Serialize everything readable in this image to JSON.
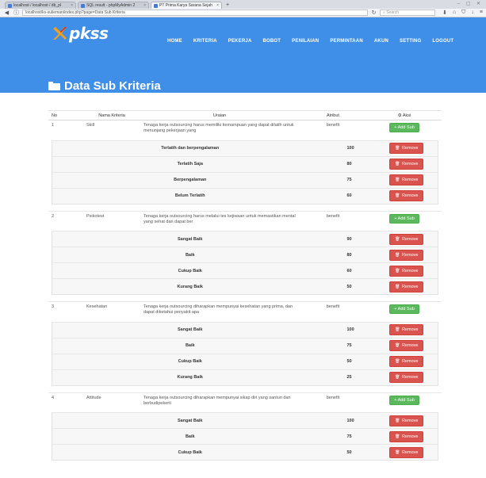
{
  "browser": {
    "tabs": [
      {
        "label": "localhost / localhost / db_pl"
      },
      {
        "label": "SQL result - phpMyAdmin 2"
      },
      {
        "label": "PT Prima Karya Sarana Sejah"
      }
    ],
    "new_tab": "+",
    "url": "localhost/ks-sulieman/index.php?page=Data Sub Kriteria",
    "search_placeholder": "Search"
  },
  "header": {
    "logo": "pkss",
    "menu": [
      "HOME",
      "KRITERIA",
      "PEKERJA",
      "BOBOT",
      "PENILAIAN",
      "PERMINTAAN",
      "AKUN",
      "SETTING",
      "LOGOUT"
    ],
    "page_title": "Data Sub Kriteria"
  },
  "table": {
    "columns": {
      "no": "No",
      "nama": "Nama Kriteria",
      "uraian": "Uraian",
      "atribut": "Atribut",
      "aksi": "Aksi"
    },
    "add_label": "+ Add Sub",
    "remove_label": "Remove",
    "criteria": [
      {
        "no": "1",
        "nama": "Skill",
        "uraian": "Tenaga kerja outsourcing harus memiliki kemampuan yang dapat dilatih untuk menunjang pekerjaan yang",
        "atribut": "benefit",
        "subs": [
          {
            "name": "Terlatih dan berpengalaman",
            "value": "100"
          },
          {
            "name": "Terlatih Saja",
            "value": "80"
          },
          {
            "name": "Berpengalaman",
            "value": "75"
          },
          {
            "name": "Belum Terlatih",
            "value": "60"
          }
        ]
      },
      {
        "no": "2",
        "nama": "Psikotest",
        "uraian": "Tenaga kerja outsourcing harus melalui tes kejiwaan untuk memastikan mental yang sehat dan dapat ber",
        "atribut": "benefit",
        "subs": [
          {
            "name": "Sangat Baik",
            "value": "90"
          },
          {
            "name": "Baik",
            "value": "80"
          },
          {
            "name": "Cukup Baik",
            "value": "60"
          },
          {
            "name": "Kurang Baik",
            "value": "50"
          }
        ]
      },
      {
        "no": "3",
        "nama": "Kesehatan",
        "uraian": "Tenaga kerja outsourcing diharapkan mempunyai kesehatan yang prima, dan dapat diketahui penyakit apa",
        "atribut": "benefit",
        "subs": [
          {
            "name": "Sangat Baik",
            "value": "100"
          },
          {
            "name": "Baik",
            "value": "75"
          },
          {
            "name": "Cukup Baik",
            "value": "50"
          },
          {
            "name": "Kurang Baik",
            "value": "25"
          }
        ]
      },
      {
        "no": "4",
        "nama": "Attitude",
        "uraian": "Tenaga kerja outsourcing diharapkan mempunyai sikap diri yang santun dan berbudipekerti",
        "atribut": "benefit",
        "subs": [
          {
            "name": "Sangat Baik",
            "value": "100"
          },
          {
            "name": "Baik",
            "value": "75"
          },
          {
            "name": "Cukup Baik",
            "value": "50"
          }
        ]
      }
    ]
  }
}
